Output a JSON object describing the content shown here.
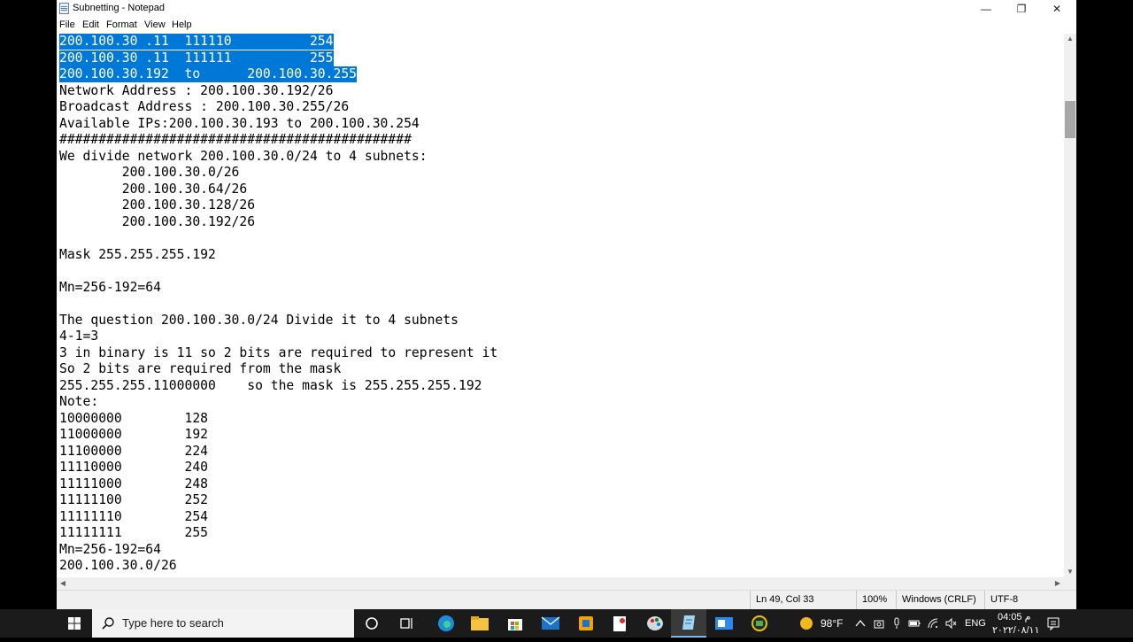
{
  "window": {
    "title": "Subnetting - Notepad",
    "controls": {
      "minimize": "—",
      "maximize": "❐",
      "close": "✕"
    }
  },
  "menu": [
    "File",
    "Edit",
    "Format",
    "View",
    "Help"
  ],
  "editor": {
    "lines": [
      {
        "text": "200.100.30 .11  111110          254",
        "selected": true
      },
      {
        "text": "200.100.30 .11  111111          255",
        "selected": true
      },
      {
        "text": "200.100.30.192  to      200.100.30.255",
        "selected": true
      },
      {
        "text": "Network Address : 200.100.30.192/26",
        "selected": false
      },
      {
        "text": "Broadcast Address : 200.100.30.255/26",
        "selected": false
      },
      {
        "text": "Available IPs:200.100.30.193 to 200.100.30.254",
        "selected": false
      },
      {
        "text": "#############################################",
        "selected": false
      },
      {
        "text": "We divide network 200.100.30.0/24 to 4 subnets:",
        "selected": false
      },
      {
        "text": "        200.100.30.0/26",
        "selected": false
      },
      {
        "text": "        200.100.30.64/26",
        "selected": false
      },
      {
        "text": "        200.100.30.128/26",
        "selected": false
      },
      {
        "text": "        200.100.30.192/26",
        "selected": false
      },
      {
        "text": "",
        "selected": false
      },
      {
        "text": "Mask 255.255.255.192",
        "selected": false
      },
      {
        "text": "",
        "selected": false
      },
      {
        "text": "Mn=256-192=64",
        "selected": false
      },
      {
        "text": "",
        "selected": false
      },
      {
        "text": "The question 200.100.30.0/24 Divide it to 4 subnets",
        "selected": false
      },
      {
        "text": "4-1=3",
        "selected": false
      },
      {
        "text": "3 in binary is 11 so 2 bits are required to represent it",
        "selected": false
      },
      {
        "text": "So 2 bits are required from the mask",
        "selected": false
      },
      {
        "text": "255.255.255.11000000    so the mask is 255.255.255.192",
        "selected": false
      },
      {
        "text": "Note:",
        "selected": false
      },
      {
        "text": "10000000        128",
        "selected": false
      },
      {
        "text": "11000000        192",
        "selected": false
      },
      {
        "text": "11100000        224",
        "selected": false
      },
      {
        "text": "11110000        240",
        "selected": false
      },
      {
        "text": "11111000        248",
        "selected": false
      },
      {
        "text": "11111100        252",
        "selected": false
      },
      {
        "text": "11111110        254",
        "selected": false
      },
      {
        "text": "11111111        255",
        "selected": false
      },
      {
        "text": "Mn=256-192=64",
        "selected": false
      },
      {
        "text": "200.100.30.0/26",
        "selected": false
      }
    ],
    "selection_color": "#0078d7"
  },
  "status": {
    "position": "Ln 49, Col 33",
    "zoom": "100%",
    "line_ending": "Windows (CRLF)",
    "encoding": "UTF-8"
  },
  "taskbar": {
    "search_placeholder": "Type here to search",
    "apps": [
      "cortana-icon",
      "task-view-icon",
      "edge-icon",
      "file-explorer-icon",
      "store-icon",
      "mail-icon",
      "app-icon",
      "app-icon",
      "paint-icon",
      "notepad-icon",
      "app-icon",
      "app-icon"
    ],
    "weather": "98°F",
    "language": "ENG",
    "time": "04:05 م",
    "date": "٢٠٢٢/٠٨/١١"
  }
}
